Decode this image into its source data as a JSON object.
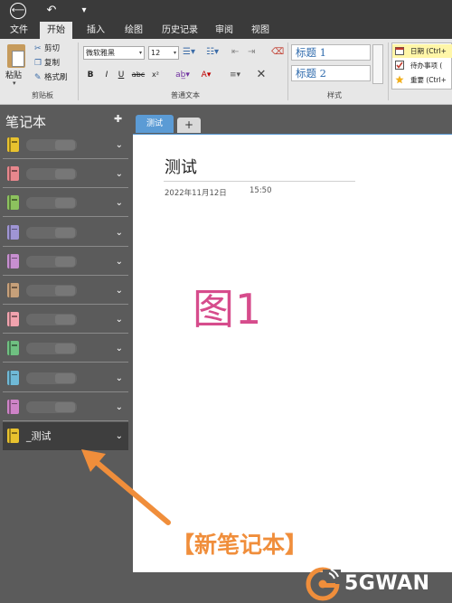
{
  "quick_access": {
    "back": "⟵",
    "undo": "↶",
    "menu": "▾"
  },
  "ribbon_tabs": [
    "文件",
    "开始",
    "插入",
    "绘图",
    "历史记录",
    "审阅",
    "视图"
  ],
  "clipboard": {
    "paste": "粘贴",
    "cut": "剪切",
    "copy": "复制",
    "format_painter": "格式刷",
    "group": "剪贴板"
  },
  "basic_text": {
    "font": "微软雅黑",
    "size": "12",
    "bold": "B",
    "italic": "I",
    "underline": "U",
    "strike": "abc",
    "superscript": "x²",
    "group": "普通文本"
  },
  "styles": {
    "heading1": "标题 1",
    "heading2": "标题 2",
    "group": "样式"
  },
  "tags": [
    "日期 (Ctrl+",
    "待办事项 (",
    "重要 (Ctrl+"
  ],
  "notebooks": {
    "title": "笔记本",
    "pin": "📌",
    "items": [
      {
        "color": "#e8c22e",
        "name": ""
      },
      {
        "color": "#e8878d",
        "name": ""
      },
      {
        "color": "#8cc25e",
        "name": ""
      },
      {
        "color": "#9f95d4",
        "name": ""
      },
      {
        "color": "#c78fd0",
        "name": ""
      },
      {
        "color": "#c6a07a",
        "name": ""
      },
      {
        "color": "#f1a3ae",
        "name": ""
      },
      {
        "color": "#6fc081",
        "name": ""
      },
      {
        "color": "#6fb9d6",
        "name": ""
      },
      {
        "color": "#ce83c7",
        "name": ""
      },
      {
        "color": "#e8c22e",
        "name": "_测试"
      }
    ]
  },
  "section_tabs": {
    "active": "测试",
    "add": "+"
  },
  "page": {
    "title": "测试",
    "date": "2022年11月12日",
    "time": "15:50",
    "figure_label": "图1"
  },
  "annotation": "【新笔记本】",
  "watermark": "5GWAN",
  "colors": {
    "accent": "#5b9bd5",
    "arrow": "#f08e3b",
    "figure": "#d64c8c"
  }
}
